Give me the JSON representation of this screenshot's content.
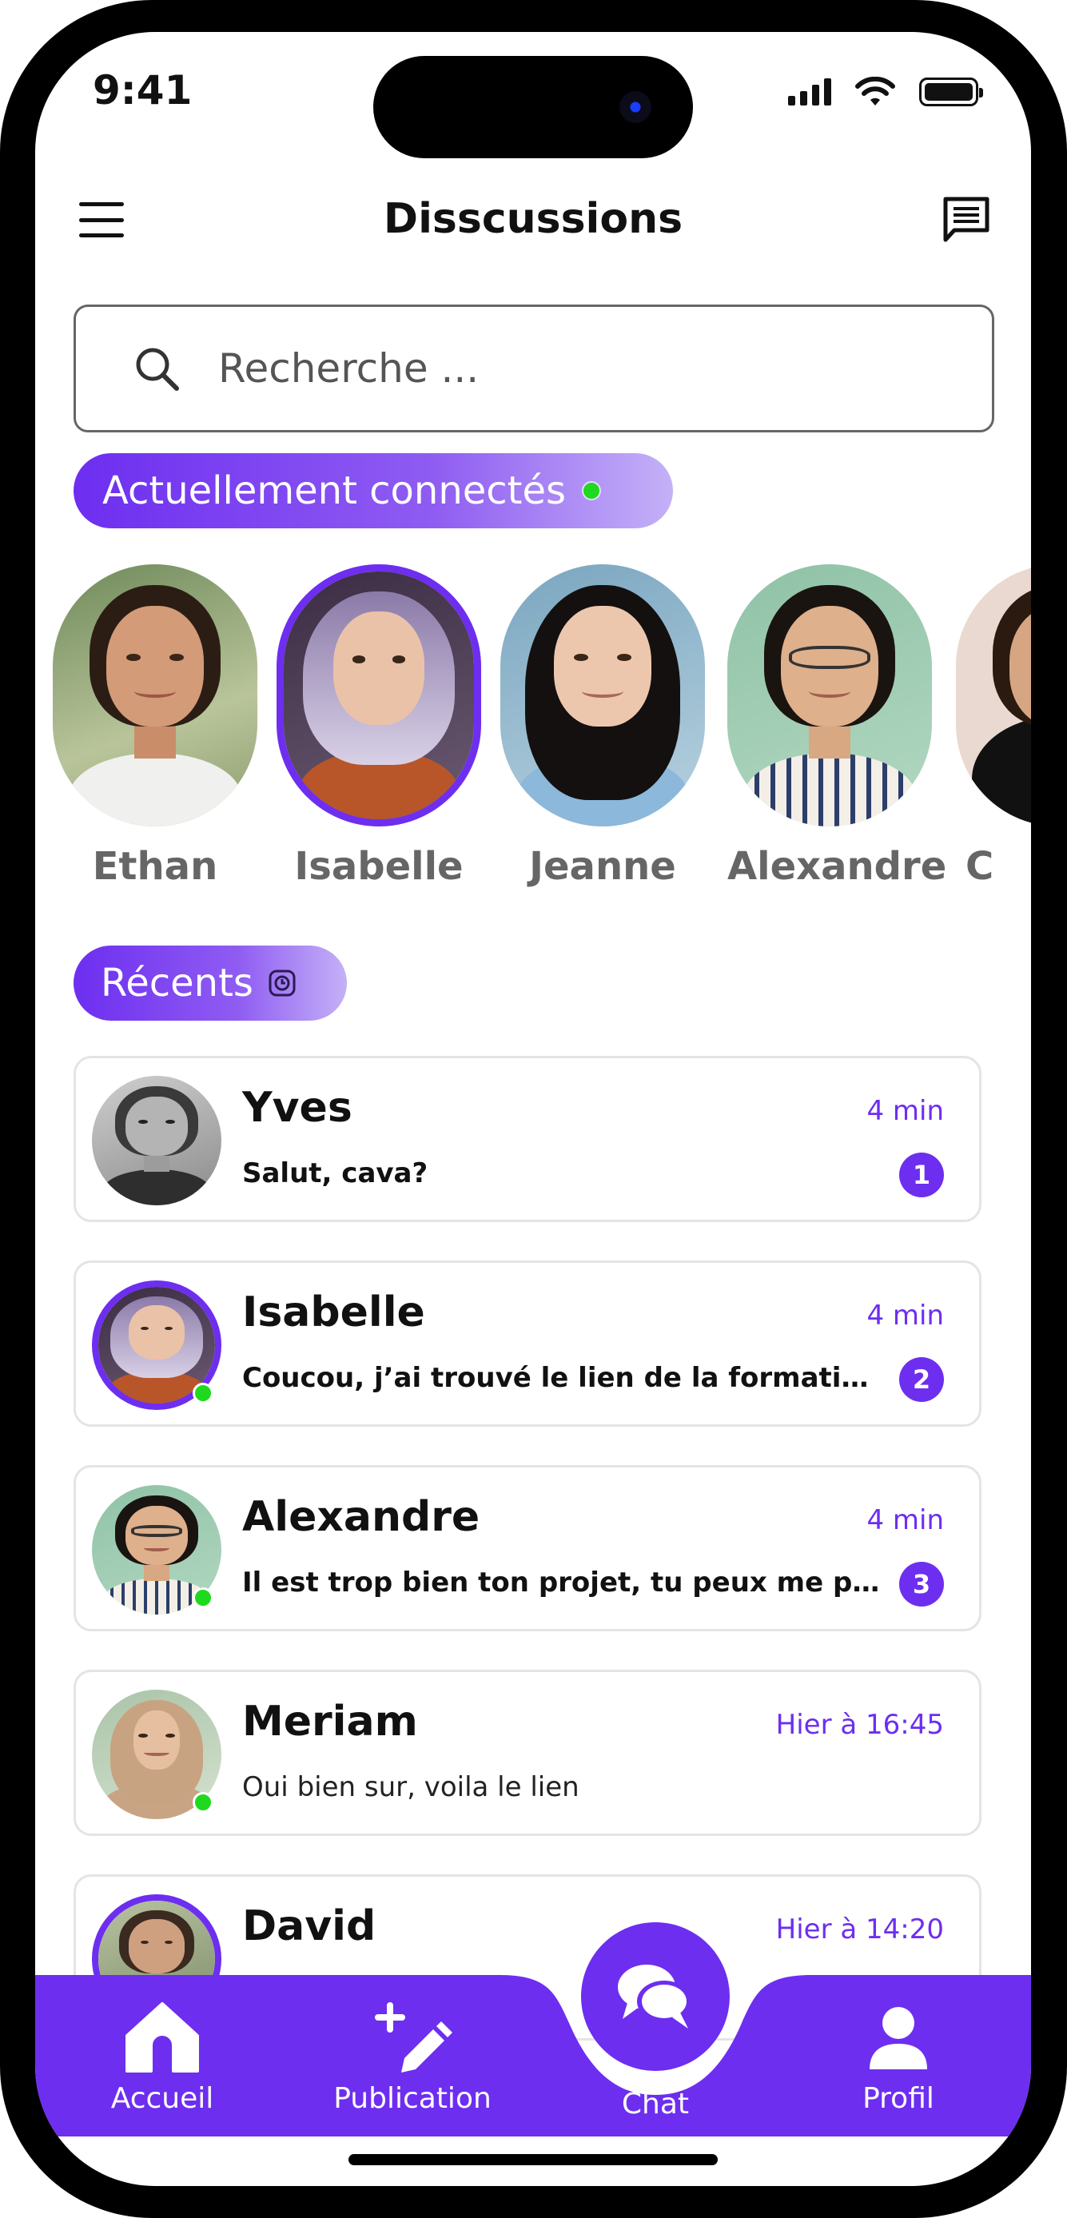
{
  "status_bar": {
    "time": "9:41"
  },
  "header": {
    "title": "Disscussions"
  },
  "search": {
    "placeholder": "Recherche ..."
  },
  "online_section": {
    "label": "Actuellement connectés"
  },
  "stories": [
    {
      "name": "Ethan"
    },
    {
      "name": "Isabelle"
    },
    {
      "name": "Jeanne"
    },
    {
      "name": "Alexandre"
    },
    {
      "name": "C"
    }
  ],
  "recent_section": {
    "label": "Récents"
  },
  "conversations": [
    {
      "name": "Yves",
      "time": "4 min",
      "message": "Salut, cava?",
      "unread": "1"
    },
    {
      "name": "Isabelle",
      "time": "4 min",
      "message": "Coucou, j’ai trouvé le lien de la formation, je...",
      "unread": "2"
    },
    {
      "name": "Alexandre",
      "time": "4 min",
      "message": "Il est trop bien ton projet, tu peux me partag...",
      "unread": "3"
    },
    {
      "name": "Meriam",
      "time": "Hier à 16:45",
      "message": "Oui bien sur, voila le lien"
    },
    {
      "name": "David",
      "time": "Hier à 14:20"
    }
  ],
  "bottom_nav": {
    "home": "Accueil",
    "publication": "Publication",
    "chat": "Chat",
    "profile": "Profil"
  },
  "colors": {
    "accent": "#6d2ef0",
    "online": "#1ed91e"
  }
}
